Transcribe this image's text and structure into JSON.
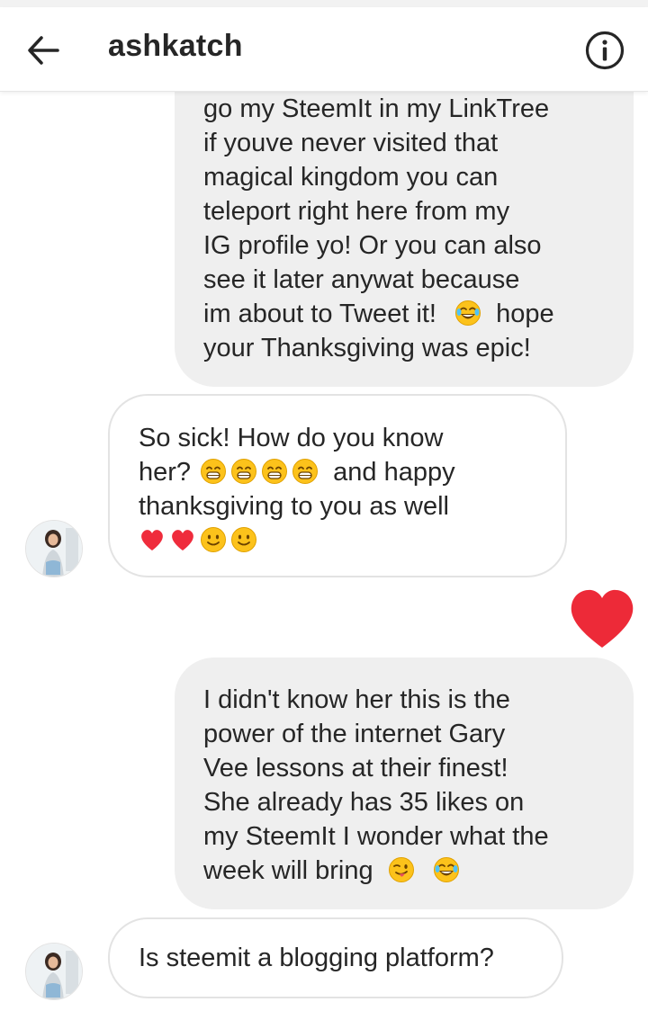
{
  "header": {
    "title": "ashkatch",
    "back_icon": "arrow-left-icon",
    "info_icon": "info-circle-icon"
  },
  "colors": {
    "outgoing_bubble": "#efefef",
    "incoming_border": "#e3e3e3",
    "heart": "#ed2a38",
    "text": "#262626"
  },
  "messages": [
    {
      "from": "me",
      "lines": [
        "go my SteemIt in my LinkTree",
        "if youve never visited that",
        "magical kingdom you can",
        "teleport right here from my",
        "IG profile yo! Or you can also",
        "see it later anywat because",
        "im about to Tweet it!",
        "hope",
        "your Thanksgiving was epic!"
      ]
    },
    {
      "from": "ashkatch",
      "lines": [
        "So sick! How do you know",
        "her?",
        "and happy",
        "thanksgiving to you as well"
      ]
    },
    {
      "from": "me",
      "lines": [
        "I didn't know her this is the",
        "power of the internet Gary",
        "Vee lessons at their finest!",
        "She already has 35 likes on",
        "my SteemIt I wonder what the",
        "week will bring"
      ]
    },
    {
      "from": "ashkatch",
      "lines": [
        "Is steemit a blogging platform?"
      ]
    }
  ]
}
